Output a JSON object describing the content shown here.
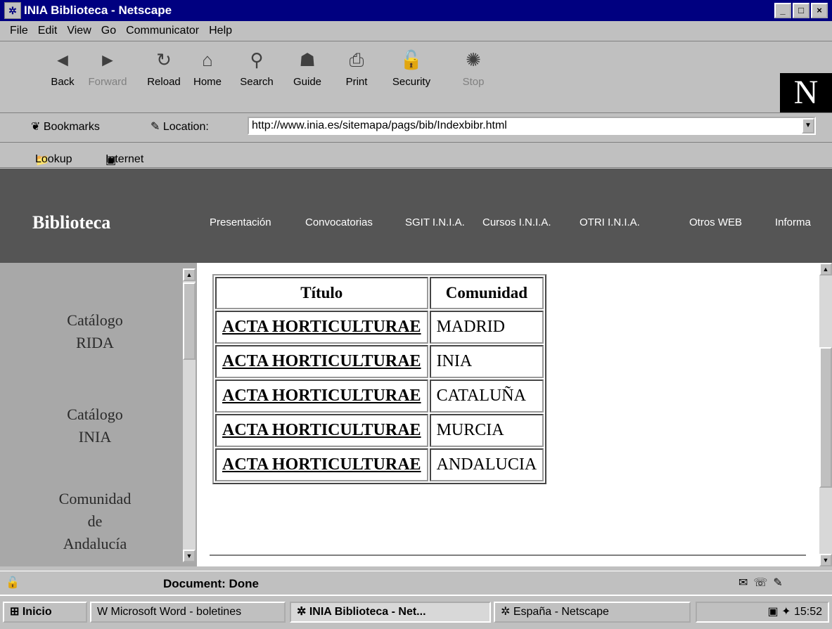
{
  "window": {
    "title": "INIA Biblioteca - Netscape"
  },
  "menu": [
    "File",
    "Edit",
    "View",
    "Go",
    "Communicator",
    "Help"
  ],
  "toolbar": [
    "Back",
    "Forward",
    "Reload",
    "Home",
    "Search",
    "Guide",
    "Print",
    "Security",
    "Stop"
  ],
  "location": {
    "bookmarks": "Bookmarks",
    "label": "Location:",
    "url": "http://www.inia.es/sitemapa/pags/bib/Indexbibr.html"
  },
  "personal": [
    "Lookup",
    "Internet"
  ],
  "header": {
    "brand": "Biblioteca",
    "nav": [
      "Presentación",
      "Convocatorias",
      "SGIT I.N.I.A.",
      "Cursos I.N.I.A.",
      "OTRI I.N.I.A.",
      "Otros WEB",
      "Informa"
    ]
  },
  "sidebar": [
    {
      "lines": [
        "Catálogo",
        "RIDA"
      ]
    },
    {
      "lines": [
        "Catálogo",
        "INIA"
      ]
    },
    {
      "lines": [
        "Comunidad",
        "de",
        "Andalucía"
      ]
    }
  ],
  "table": {
    "headers": [
      "Título",
      "Comunidad"
    ],
    "rows": [
      [
        "ACTA HORTICULTURAE",
        "MADRID"
      ],
      [
        "ACTA HORTICULTURAE",
        "INIA"
      ],
      [
        "ACTA HORTICULTURAE",
        "CATALUÑA"
      ],
      [
        "ACTA HORTICULTURAE",
        "MURCIA"
      ],
      [
        "ACTA HORTICULTURAE",
        "ANDALUCIA"
      ]
    ]
  },
  "status": "Document: Done",
  "taskbar": {
    "start": "Inicio",
    "items": [
      "Microsoft Word - boletines",
      "INIA Biblioteca - Net...",
      "España - Netscape"
    ],
    "clock": "15:52"
  }
}
